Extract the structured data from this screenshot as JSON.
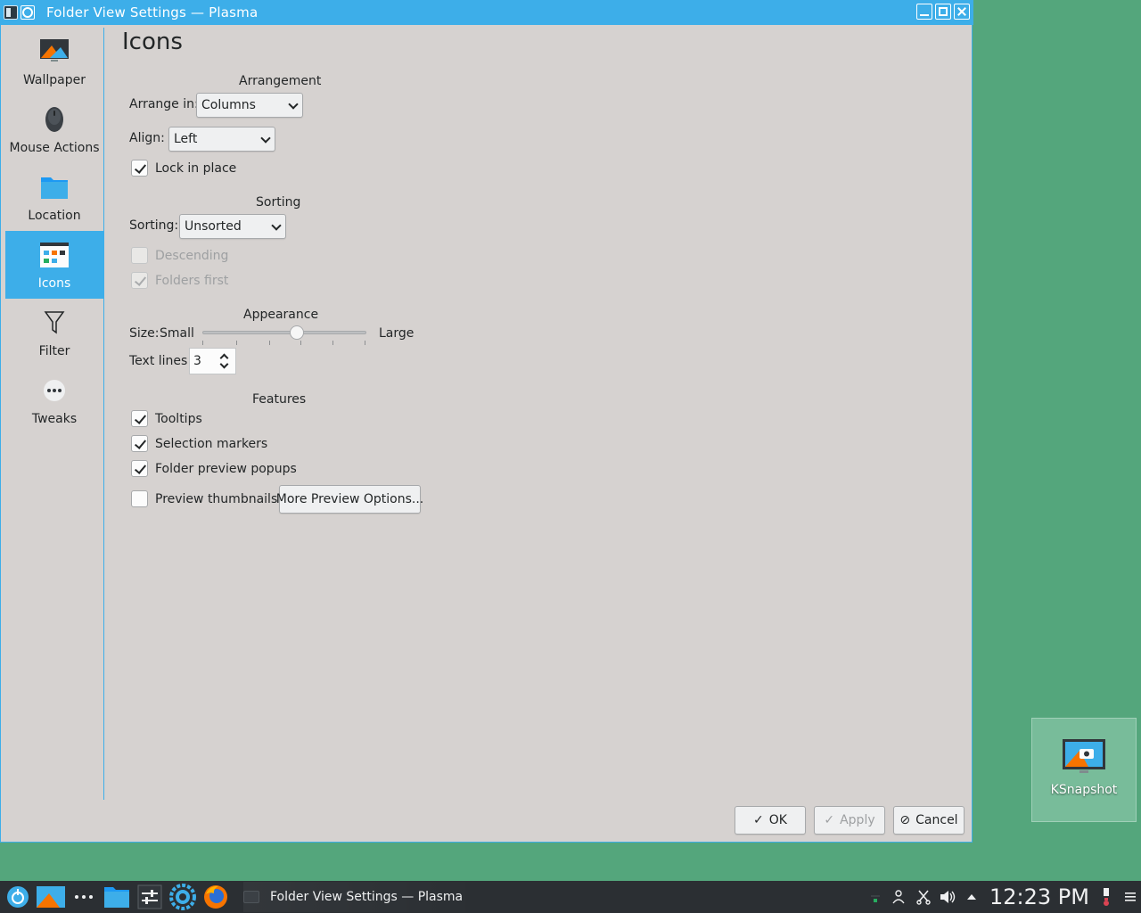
{
  "window": {
    "title": "Folder View Settings — Plasma"
  },
  "sidebar": {
    "items": [
      {
        "label": "Wallpaper",
        "icon": "wallpaper-icon"
      },
      {
        "label": "Mouse Actions",
        "icon": "mouse-icon"
      },
      {
        "label": "Location",
        "icon": "folder-icon"
      },
      {
        "label": "Icons",
        "icon": "icons-view-icon",
        "active": true
      },
      {
        "label": "Filter",
        "icon": "filter-icon"
      },
      {
        "label": "Tweaks",
        "icon": "more-icon"
      }
    ]
  },
  "page": {
    "title": "Icons",
    "arrangement": {
      "heading": "Arrangement",
      "arrange_label": "Arrange in:",
      "arrange_value": "Columns",
      "align_label": "Align:",
      "align_value": "Left",
      "lock_label": "Lock in place",
      "lock_checked": true
    },
    "sorting": {
      "heading": "Sorting",
      "sorting_label": "Sorting:",
      "sorting_value": "Unsorted",
      "descending_label": "Descending",
      "descending_checked": false,
      "folders_first_label": "Folders first",
      "folders_first_checked": true
    },
    "appearance": {
      "heading": "Appearance",
      "size_label": "Size:",
      "size_min_label": "Small",
      "size_max_label": "Large",
      "size_value": 0.58,
      "text_lines_label": "Text lines:",
      "text_lines_value": "3"
    },
    "features": {
      "heading": "Features",
      "tooltips_label": "Tooltips",
      "tooltips_checked": true,
      "selection_markers_label": "Selection markers",
      "selection_markers_checked": true,
      "folder_preview_label": "Folder preview popups",
      "folder_preview_checked": true,
      "preview_thumbnails_label": "Preview thumbnails",
      "preview_thumbnails_checked": false,
      "more_preview_button": "More Preview Options..."
    }
  },
  "buttons": {
    "ok": "OK",
    "apply": "Apply",
    "cancel": "Cancel"
  },
  "desktop": {
    "widget_label": "KSnapshot"
  },
  "taskbar": {
    "task_title": "Folder View Settings — Plasma",
    "clock": "12:23 PM"
  },
  "colors": {
    "accent": "#3daee9",
    "desktop": "#54a67c",
    "window_bg": "#d6d2d0",
    "taskbar": "#2b2f33"
  }
}
